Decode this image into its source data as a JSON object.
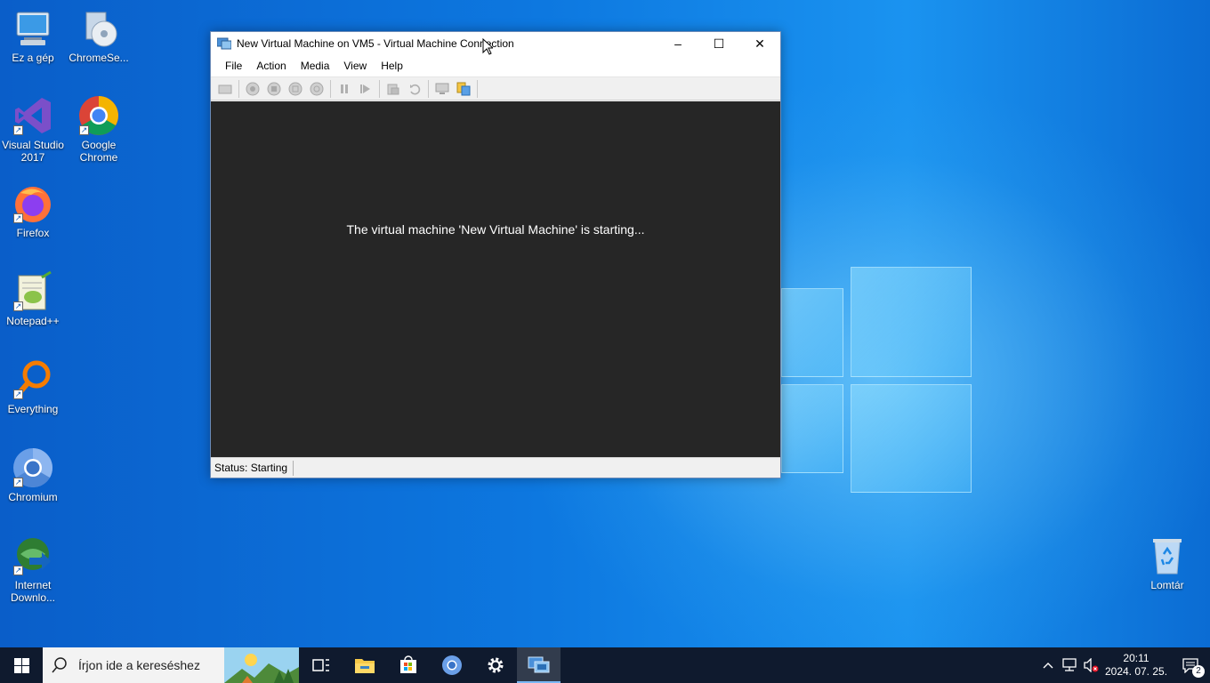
{
  "desktop": {
    "icons": [
      {
        "label": "Ez a gép"
      },
      {
        "label": "ChromeSe..."
      },
      {
        "label": "Visual Studio 2017"
      },
      {
        "label": "Google Chrome"
      },
      {
        "label": "Firefox"
      },
      {
        "label": "Notepad++"
      },
      {
        "label": "Everything"
      },
      {
        "label": "Chromium"
      },
      {
        "label": "Internet Downlo..."
      },
      {
        "label": "Lomtár"
      }
    ]
  },
  "vm_window": {
    "title": "New Virtual Machine on VM5 - Virtual Machine Connection",
    "controls": {
      "minimize": "–",
      "maximize": "☐",
      "close": "✕"
    },
    "menu": [
      "File",
      "Action",
      "Media",
      "View",
      "Help"
    ],
    "toolbar_icons": [
      "ctrl-alt-del-icon",
      "start-icon",
      "turn-off-icon",
      "shut-down-icon",
      "save-icon",
      "pause-icon",
      "reset-icon",
      "checkpoint-icon",
      "revert-icon",
      "enhanced-session-icon",
      "share-icon"
    ],
    "screen_message": "The virtual machine 'New Virtual Machine' is starting...",
    "status": "Status: Starting"
  },
  "taskbar": {
    "search_placeholder": "Írjon ide a kereséshez",
    "apps": [
      "task-view-icon",
      "file-explorer-icon",
      "store-icon",
      "chromium-icon",
      "settings-icon",
      "vm-connect-icon"
    ],
    "clock_time": "20:11",
    "clock_date": "2024. 07. 25.",
    "notification_count": "2"
  }
}
